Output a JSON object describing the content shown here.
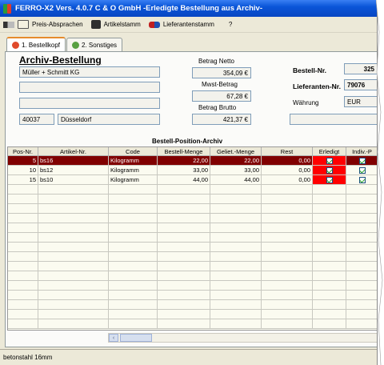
{
  "window": {
    "title": "FERRO-X2 Vers. 4.0.7  C & O GmbH -Erledigte Bestellung aus Archiv-"
  },
  "menu": {
    "preis": "Preis-Absprachen",
    "artikel": "Artikelstamm",
    "lieferanten": "Lieferantenstamm",
    "help": "?"
  },
  "tabs": {
    "tab1": "1. Bestellkopf",
    "tab2": "2. Sonstiges"
  },
  "form": {
    "heading": "Archiv-Bestellung",
    "addr1": "Müller + Schmitt KG",
    "addr2": "",
    "addr3": "",
    "plz": "40037",
    "ort": "Düsseldorf",
    "netto_label": "Betrag Netto",
    "netto": "354,09 €",
    "mwst_label": "Mwst-Betrag",
    "mwst": "67,28 €",
    "brutto_label": "Betrag Brutto",
    "brutto": "421,37 €",
    "bestellnr_label": "Bestell-Nr.",
    "bestellnr": "325",
    "liefnr_label": "Lieferanten-Nr.",
    "liefnr": "79076",
    "waehrung_label": "Währung",
    "waehrung": "EUR"
  },
  "grid": {
    "title": "Bestell-Position-Archiv",
    "headers": [
      "Pos-Nr.",
      "Artikel-Nr.",
      "Code",
      "Bestell-Menge",
      "Geliet.-Menge",
      "Rest",
      "Erledigt",
      "Indiv.-P"
    ],
    "rows": [
      {
        "pos": "5",
        "art": "bs16",
        "code": "Kilogramm",
        "bestell": "22,00",
        "geliefert": "22,00",
        "rest": "0,00",
        "erledigt": true,
        "indiv": true
      },
      {
        "pos": "10",
        "art": "bs12",
        "code": "Kilogramm",
        "bestell": "33,00",
        "geliefert": "33,00",
        "rest": "0,00",
        "erledigt": true,
        "indiv": true
      },
      {
        "pos": "15",
        "art": "bs10",
        "code": "Kilogramm",
        "bestell": "44,00",
        "geliefert": "44,00",
        "rest": "0,00",
        "erledigt": true,
        "indiv": true
      }
    ]
  },
  "status": {
    "text": "betonstahl 16mm"
  },
  "colors": {
    "selected_row": "#800000",
    "erledigt_cell": "#ff0000",
    "title_bar": "#0a55d8"
  },
  "icons": {
    "app": "ferro-logo",
    "preis": "preis-icon",
    "artikel": "artikel-icon",
    "lieferanten": "lieferanten-icon"
  }
}
